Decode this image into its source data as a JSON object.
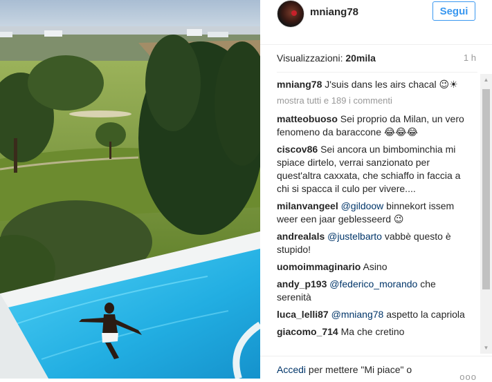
{
  "post": {
    "username": "mniang78",
    "follow_label": "Segui",
    "views_label": "Visualizzazioni: ",
    "views_value": "20mila",
    "time": "1 h",
    "caption_user": "mniang78",
    "caption_text": "J'suis dans les airs chacal 😉☀",
    "load_more": "mostra tutti e 189 i commenti"
  },
  "comments": [
    {
      "user": "matteobuoso",
      "text": "Sei proprio da Milan, un vero fenomeno da baraccone 😂😂😂"
    },
    {
      "user": "ciscov86",
      "text": "Sei ancora un bimbominchia mi spiace dirtelo, verrai sanzionato per quest'altra caxxata, che schiaffo in faccia a chi si spacca il culo per vivere...."
    },
    {
      "user": "milanvangeel",
      "mention": "@gildoow",
      "text": " binnekort issem weer een jaar geblesseerd 😉"
    },
    {
      "user": "andrealals",
      "mention": "@justelbarto",
      "text": " vabbè questo è stupido!"
    },
    {
      "user": "uomoimmaginario",
      "text": "Asino"
    },
    {
      "user": "andy_p193",
      "mention": "@federico_morando",
      "text": " che serenità"
    },
    {
      "user": "luca_lelli87",
      "mention": "@mniang78",
      "text": " aspetto la capriola"
    },
    {
      "user": "giacomo_714",
      "text": "Ma che cretino"
    }
  ],
  "footer": {
    "login_link": "Accedi",
    "login_text": " per mettere \"Mi piace\" o",
    "more": "ooo"
  },
  "colors": {
    "accent": "#3897f0",
    "link": "#003569",
    "muted": "#999999",
    "pool": "#29b6e8",
    "grass": "#7d9a3c"
  },
  "icons": {
    "options": "more-options-icon",
    "scroll_up": "scroll-up-arrow-icon",
    "scroll_down": "scroll-down-arrow-icon"
  }
}
